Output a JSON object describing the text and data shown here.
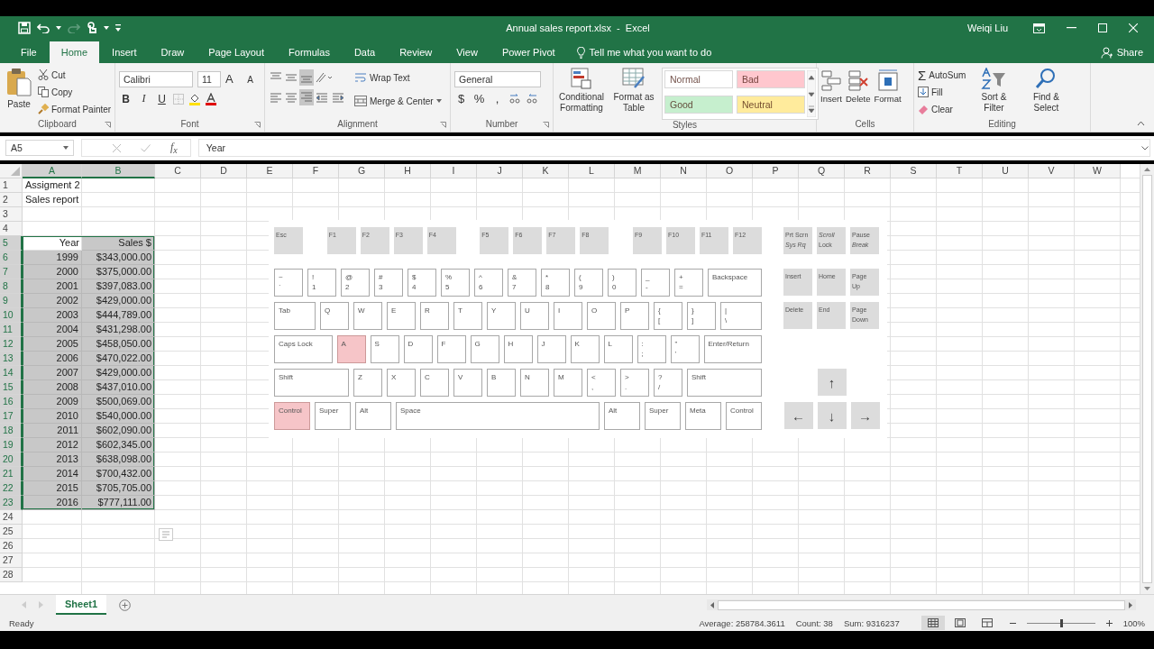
{
  "title_bar": {
    "title": "Annual sales report.xlsx  -  Excel",
    "user": "Weiqi Liu"
  },
  "tabs": [
    {
      "label": "File",
      "selected": false
    },
    {
      "label": "Home",
      "selected": true
    },
    {
      "label": "Insert",
      "selected": false
    },
    {
      "label": "Draw",
      "selected": false
    },
    {
      "label": "Page Layout",
      "selected": false
    },
    {
      "label": "Formulas",
      "selected": false
    },
    {
      "label": "Data",
      "selected": false
    },
    {
      "label": "Review",
      "selected": false
    },
    {
      "label": "View",
      "selected": false
    },
    {
      "label": "Power Pivot",
      "selected": false
    }
  ],
  "tell_me": "Tell me what you want to do",
  "share": "Share",
  "ribbon": {
    "clipboard": {
      "paste": "Paste",
      "cut": "Cut",
      "copy": "Copy",
      "format_painter": "Format Painter",
      "label": "Clipboard"
    },
    "font": {
      "name": "Calibri",
      "size": "11",
      "grow": "A",
      "shrink": "A",
      "bold": "B",
      "italic": "I",
      "underline": "U",
      "label": "Font"
    },
    "alignment": {
      "wrap_text": "Wrap Text",
      "merge": "Merge & Center",
      "label": "Alignment"
    },
    "number": {
      "format": "General",
      "currency": "$",
      "percent": "%",
      "comma": ",",
      "label": "Number"
    },
    "styles": {
      "conditional": "Conditional Formatting",
      "format_table": "Format as Table",
      "label": "Styles",
      "cell_styles": [
        {
          "label": "Normal",
          "color": "#ffffff"
        },
        {
          "label": "Bad",
          "color": "#ffc7ce"
        },
        {
          "label": "Good",
          "color": "#c6efce"
        },
        {
          "label": "Neutral",
          "color": "#ffeb9c"
        }
      ]
    },
    "cells": {
      "label": "Cells",
      "buttons": [
        {
          "label": "Insert",
          "kind": "insert"
        },
        {
          "label": "Delete",
          "kind": "delete"
        },
        {
          "label": "Format",
          "kind": "format"
        }
      ]
    },
    "editing": {
      "autosum_symbol": "Σ",
      "autosum": "AutoSum",
      "fill": "Fill",
      "clear": "Clear",
      "sort": "Sort & Filter",
      "find": "Find & Select",
      "label": "Editing"
    }
  },
  "formula_bar": {
    "name_box": "A5",
    "fx": "f$_{x}$",
    "formula": "Year"
  },
  "grid": {
    "columns": [
      {
        "label": "A",
        "selected": true
      },
      {
        "label": "B",
        "selected": true
      },
      {
        "label": "C",
        "selected": false
      },
      {
        "label": "D",
        "selected": false
      },
      {
        "label": "E",
        "selected": false
      },
      {
        "label": "F",
        "selected": false
      },
      {
        "label": "G",
        "selected": false
      },
      {
        "label": "H",
        "selected": false
      },
      {
        "label": "I",
        "selected": false
      },
      {
        "label": "J",
        "selected": false
      },
      {
        "label": "K",
        "selected": false
      },
      {
        "label": "L",
        "selected": false
      },
      {
        "label": "M",
        "selected": false
      },
      {
        "label": "N",
        "selected": false
      },
      {
        "label": "O",
        "selected": false
      },
      {
        "label": "P",
        "selected": false
      },
      {
        "label": "Q",
        "selected": false
      },
      {
        "label": "R",
        "selected": false
      },
      {
        "label": "S",
        "selected": false
      },
      {
        "label": "T",
        "selected": false
      },
      {
        "label": "U",
        "selected": false
      },
      {
        "label": "V",
        "selected": false
      },
      {
        "label": "W",
        "selected": false
      }
    ],
    "rows": [
      {
        "label": "1",
        "selected": false,
        "cells": [
          {
            "text": "Assigment 2",
            "kind": "text",
            "selected": false
          }
        ]
      },
      {
        "label": "2",
        "selected": false,
        "cells": [
          {
            "text": "Sales report",
            "kind": "text",
            "selected": false
          }
        ]
      },
      {
        "label": "3",
        "selected": false
      },
      {
        "label": "4",
        "selected": false
      },
      {
        "label": "5",
        "selected": true,
        "cells": [
          {
            "text": "Year",
            "kind": "heading",
            "selected": false
          },
          {
            "text": "Sales $",
            "kind": "heading",
            "selected": true
          }
        ]
      },
      {
        "label": "6",
        "selected": true,
        "cells": [
          {
            "text": "1999",
            "kind": "number",
            "selected": true
          },
          {
            "text": "$343,000.00",
            "kind": "number",
            "selected": true
          }
        ]
      },
      {
        "label": "7",
        "selected": true,
        "cells": [
          {
            "text": "2000",
            "kind": "number",
            "selected": true
          },
          {
            "text": "$375,000.00",
            "kind": "number",
            "selected": true
          }
        ]
      },
      {
        "label": "8",
        "selected": true,
        "cells": [
          {
            "text": "2001",
            "kind": "number",
            "selected": true
          },
          {
            "text": "$397,083.00",
            "kind": "number",
            "selected": true
          }
        ]
      },
      {
        "label": "9",
        "selected": true,
        "cells": [
          {
            "text": "2002",
            "kind": "number",
            "selected": true
          },
          {
            "text": "$429,000.00",
            "kind": "number",
            "selected": true
          }
        ]
      },
      {
        "label": "10",
        "selected": true,
        "cells": [
          {
            "text": "2003",
            "kind": "number",
            "selected": true
          },
          {
            "text": "$444,789.00",
            "kind": "number",
            "selected": true
          }
        ]
      },
      {
        "label": "11",
        "selected": true,
        "cells": [
          {
            "text": "2004",
            "kind": "number",
            "selected": true
          },
          {
            "text": "$431,298.00",
            "kind": "number",
            "selected": true
          }
        ]
      },
      {
        "label": "12",
        "selected": true,
        "cells": [
          {
            "text": "2005",
            "kind": "number",
            "selected": true
          },
          {
            "text": "$458,050.00",
            "kind": "number",
            "selected": true
          }
        ]
      },
      {
        "label": "13",
        "selected": true,
        "cells": [
          {
            "text": "2006",
            "kind": "number",
            "selected": true
          },
          {
            "text": "$470,022.00",
            "kind": "number",
            "selected": true
          }
        ]
      },
      {
        "label": "14",
        "selected": true,
        "cells": [
          {
            "text": "2007",
            "kind": "number",
            "selected": true
          },
          {
            "text": "$429,000.00",
            "kind": "number",
            "selected": true
          }
        ]
      },
      {
        "label": "15",
        "selected": true,
        "cells": [
          {
            "text": "2008",
            "kind": "number",
            "selected": true
          },
          {
            "text": "$437,010.00",
            "kind": "number",
            "selected": true
          }
        ]
      },
      {
        "label": "16",
        "selected": true,
        "cells": [
          {
            "text": "2009",
            "kind": "number",
            "selected": true
          },
          {
            "text": "$500,069.00",
            "kind": "number",
            "selected": true
          }
        ]
      },
      {
        "label": "17",
        "selected": true,
        "cells": [
          {
            "text": "2010",
            "kind": "number",
            "selected": true
          },
          {
            "text": "$540,000.00",
            "kind": "number",
            "selected": true
          }
        ]
      },
      {
        "label": "18",
        "selected": true,
        "cells": [
          {
            "text": "2011",
            "kind": "number",
            "selected": true
          },
          {
            "text": "$602,090.00",
            "kind": "number",
            "selected": true
          }
        ]
      },
      {
        "label": "19",
        "selected": true,
        "cells": [
          {
            "text": "2012",
            "kind": "number",
            "selected": true
          },
          {
            "text": "$602,345.00",
            "kind": "number",
            "selected": true
          }
        ]
      },
      {
        "label": "20",
        "selected": true,
        "cells": [
          {
            "text": "2013",
            "kind": "number",
            "selected": true
          },
          {
            "text": "$638,098.00",
            "kind": "number",
            "selected": true
          }
        ]
      },
      {
        "label": "21",
        "selected": true,
        "cells": [
          {
            "text": "2014",
            "kind": "number",
            "selected": true
          },
          {
            "text": "$700,432.00",
            "kind": "number",
            "selected": true
          }
        ]
      },
      {
        "label": "22",
        "selected": true,
        "cells": [
          {
            "text": "2015",
            "kind": "number",
            "selected": true
          },
          {
            "text": "$705,705.00",
            "kind": "number",
            "selected": true
          }
        ]
      },
      {
        "label": "23",
        "selected": true,
        "cells": [
          {
            "text": "2016",
            "kind": "number",
            "selected": true
          },
          {
            "text": "$777,111.00",
            "kind": "number",
            "selected": true
          }
        ]
      },
      {
        "label": "24",
        "selected": false
      },
      {
        "label": "25",
        "selected": false
      },
      {
        "label": "26",
        "selected": false
      },
      {
        "label": "27",
        "selected": false
      },
      {
        "label": "28",
        "selected": false
      }
    ]
  },
  "keyboard": {
    "function_row": [
      [
        {
          "label": "Esc",
          "kind": "fn",
          "pressed": false
        }
      ],
      [
        {
          "label": "F1",
          "kind": "fn",
          "pressed": false
        },
        {
          "label": "F2",
          "kind": "fn",
          "pressed": false
        },
        {
          "label": "F3",
          "kind": "fn",
          "pressed": false
        },
        {
          "label": "F4",
          "kind": "fn",
          "pressed": false
        }
      ],
      [
        {
          "label": "F5",
          "kind": "fn",
          "pressed": false
        },
        {
          "label": "F6",
          "kind": "fn",
          "pressed": false
        },
        {
          "label": "F7",
          "kind": "fn",
          "pressed": false
        },
        {
          "label": "F8",
          "kind": "fn",
          "pressed": false
        }
      ],
      [
        {
          "label": "F9",
          "kind": "fn",
          "pressed": false
        },
        {
          "label": "F10",
          "kind": "fn",
          "pressed": false
        },
        {
          "label": "F11",
          "kind": "fn",
          "pressed": false
        },
        {
          "label": "F12",
          "kind": "fn",
          "pressed": false
        }
      ]
    ],
    "main_rows": [
      [
        {
          "label": "~\n`",
          "kind": "key",
          "pressed": false
        },
        {
          "label": "!\n1",
          "kind": "key",
          "pressed": false
        },
        {
          "label": "@\n2",
          "kind": "key",
          "pressed": false
        },
        {
          "label": "#\n3",
          "kind": "key",
          "pressed": false
        },
        {
          "label": "$\n4",
          "kind": "key",
          "pressed": false
        },
        {
          "label": "%\n5",
          "kind": "key",
          "pressed": false
        },
        {
          "label": "^\n6",
          "kind": "key",
          "pressed": false
        },
        {
          "label": "&\n7",
          "kind": "key",
          "pressed": false
        },
        {
          "label": "*\n8",
          "kind": "key",
          "pressed": false
        },
        {
          "label": "(\n9",
          "kind": "key",
          "pressed": false
        },
        {
          "label": ")\n0",
          "kind": "key",
          "pressed": false
        },
        {
          "label": "_\n-",
          "kind": "key",
          "pressed": false
        },
        {
          "label": "+\n=",
          "kind": "key",
          "pressed": false
        },
        {
          "label": "Backspace",
          "kind": "wide",
          "pressed": false
        }
      ],
      [
        {
          "label": "Tab",
          "kind": "wide",
          "pressed": false
        },
        {
          "label": "Q",
          "kind": "key",
          "pressed": false
        },
        {
          "label": "W",
          "kind": "key",
          "pressed": false
        },
        {
          "label": "E",
          "kind": "key",
          "pressed": false
        },
        {
          "label": "R",
          "kind": "key",
          "pressed": false
        },
        {
          "label": "T",
          "kind": "key",
          "pressed": false
        },
        {
          "label": "Y",
          "kind": "key",
          "pressed": false
        },
        {
          "label": "U",
          "kind": "key",
          "pressed": false
        },
        {
          "label": "I",
          "kind": "key",
          "pressed": false
        },
        {
          "label": "O",
          "kind": "key",
          "pressed": false
        },
        {
          "label": "P",
          "kind": "key",
          "pressed": false
        },
        {
          "label": "{\n[",
          "kind": "key",
          "pressed": false
        },
        {
          "label": "}\n]",
          "kind": "key",
          "pressed": false
        },
        {
          "label": "|\n\\",
          "kind": "wide",
          "pressed": false
        }
      ],
      [
        {
          "label": "Caps Lock",
          "kind": "wide",
          "pressed": false
        },
        {
          "label": "A",
          "kind": "key",
          "pressed": true
        },
        {
          "label": "S",
          "kind": "key",
          "pressed": false
        },
        {
          "label": "D",
          "kind": "key",
          "pressed": false
        },
        {
          "label": "F",
          "kind": "key",
          "pressed": false
        },
        {
          "label": "G",
          "kind": "key",
          "pressed": false
        },
        {
          "label": "H",
          "kind": "key",
          "pressed": false
        },
        {
          "label": "J",
          "kind": "key",
          "pressed": false
        },
        {
          "label": "K",
          "kind": "key",
          "pressed": false
        },
        {
          "label": "L",
          "kind": "key",
          "pressed": false
        },
        {
          "label": ":\n;",
          "kind": "key",
          "pressed": false
        },
        {
          "label": "\"\n'",
          "kind": "key",
          "pressed": false
        },
        {
          "label": "Enter/Return",
          "kind": "wide",
          "pressed": false
        }
      ],
      [
        {
          "label": "Shift",
          "kind": "wide",
          "pressed": false
        },
        {
          "label": "Z",
          "kind": "key",
          "pressed": false
        },
        {
          "label": "X",
          "kind": "key",
          "pressed": false
        },
        {
          "label": "C",
          "kind": "key",
          "pressed": false
        },
        {
          "label": "V",
          "kind": "key",
          "pressed": false
        },
        {
          "label": "B",
          "kind": "key",
          "pressed": false
        },
        {
          "label": "N",
          "kind": "key",
          "pressed": false
        },
        {
          "label": "M",
          "kind": "key",
          "pressed": false
        },
        {
          "label": "<\n,",
          "kind": "key",
          "pressed": false
        },
        {
          "label": ">\n.",
          "kind": "key",
          "pressed": false
        },
        {
          "label": "?\n/",
          "kind": "key",
          "pressed": false
        },
        {
          "label": "Shift",
          "kind": "wide",
          "pressed": false
        }
      ],
      [
        {
          "label": "Control",
          "kind": "mod",
          "pressed": true
        },
        {
          "label": "Super",
          "kind": "mod",
          "pressed": false
        },
        {
          "label": "Alt",
          "kind": "mod",
          "pressed": false
        },
        {
          "label": "Space",
          "kind": "space",
          "pressed": false
        },
        {
          "label": "Alt",
          "kind": "mod",
          "pressed": false
        },
        {
          "label": "Super",
          "kind": "mod",
          "pressed": false
        },
        {
          "label": "Meta",
          "kind": "mod",
          "pressed": false
        },
        {
          "label": "Control",
          "kind": "mod",
          "pressed": false
        }
      ]
    ],
    "system_keys": [
      {
        "label": "Prt Scrn\n*Sys Rq*",
        "kind": "fn",
        "pressed": false
      },
      {
        "label": "*Scroll*\nLock",
        "kind": "fn",
        "pressed": false
      },
      {
        "label": "Pause\n*Break*",
        "kind": "fn",
        "pressed": false
      }
    ],
    "nav_rows": [
      [
        {
          "label": "Insert",
          "kind": "fn",
          "pressed": false
        },
        {
          "label": "Home",
          "kind": "fn",
          "pressed": false
        },
        {
          "label": "Page\nUp",
          "kind": "fn",
          "pressed": false
        }
      ],
      [
        {
          "label": "Delete",
          "kind": "fn",
          "pressed": false
        },
        {
          "label": "End",
          "kind": "fn",
          "pressed": false
        },
        {
          "label": "Page\nDown",
          "kind": "fn",
          "pressed": false
        }
      ]
    ],
    "arrow_rows": [
      [
        {
          "label": "↑",
          "kind": "arrow",
          "pressed": false
        }
      ],
      [
        {
          "label": "←",
          "kind": "arrow",
          "pressed": false
        },
        {
          "label": "↓",
          "kind": "arrow",
          "pressed": false
        },
        {
          "label": "→",
          "kind": "arrow",
          "pressed": false
        }
      ]
    ]
  },
  "sheet_tabs": [
    {
      "label": "Sheet1",
      "selected": true
    }
  ],
  "status_bar": {
    "ready": "Ready",
    "average": "Average: 258784.3611",
    "count": "Count: 38",
    "sum": "Sum: 9316237",
    "views": [
      {
        "kind": "normal",
        "selected": true
      },
      {
        "kind": "page_layout",
        "selected": false
      },
      {
        "kind": "page_break",
        "selected": false
      }
    ],
    "zoom": {
      "level": 0.5,
      "reading": "100%"
    }
  }
}
